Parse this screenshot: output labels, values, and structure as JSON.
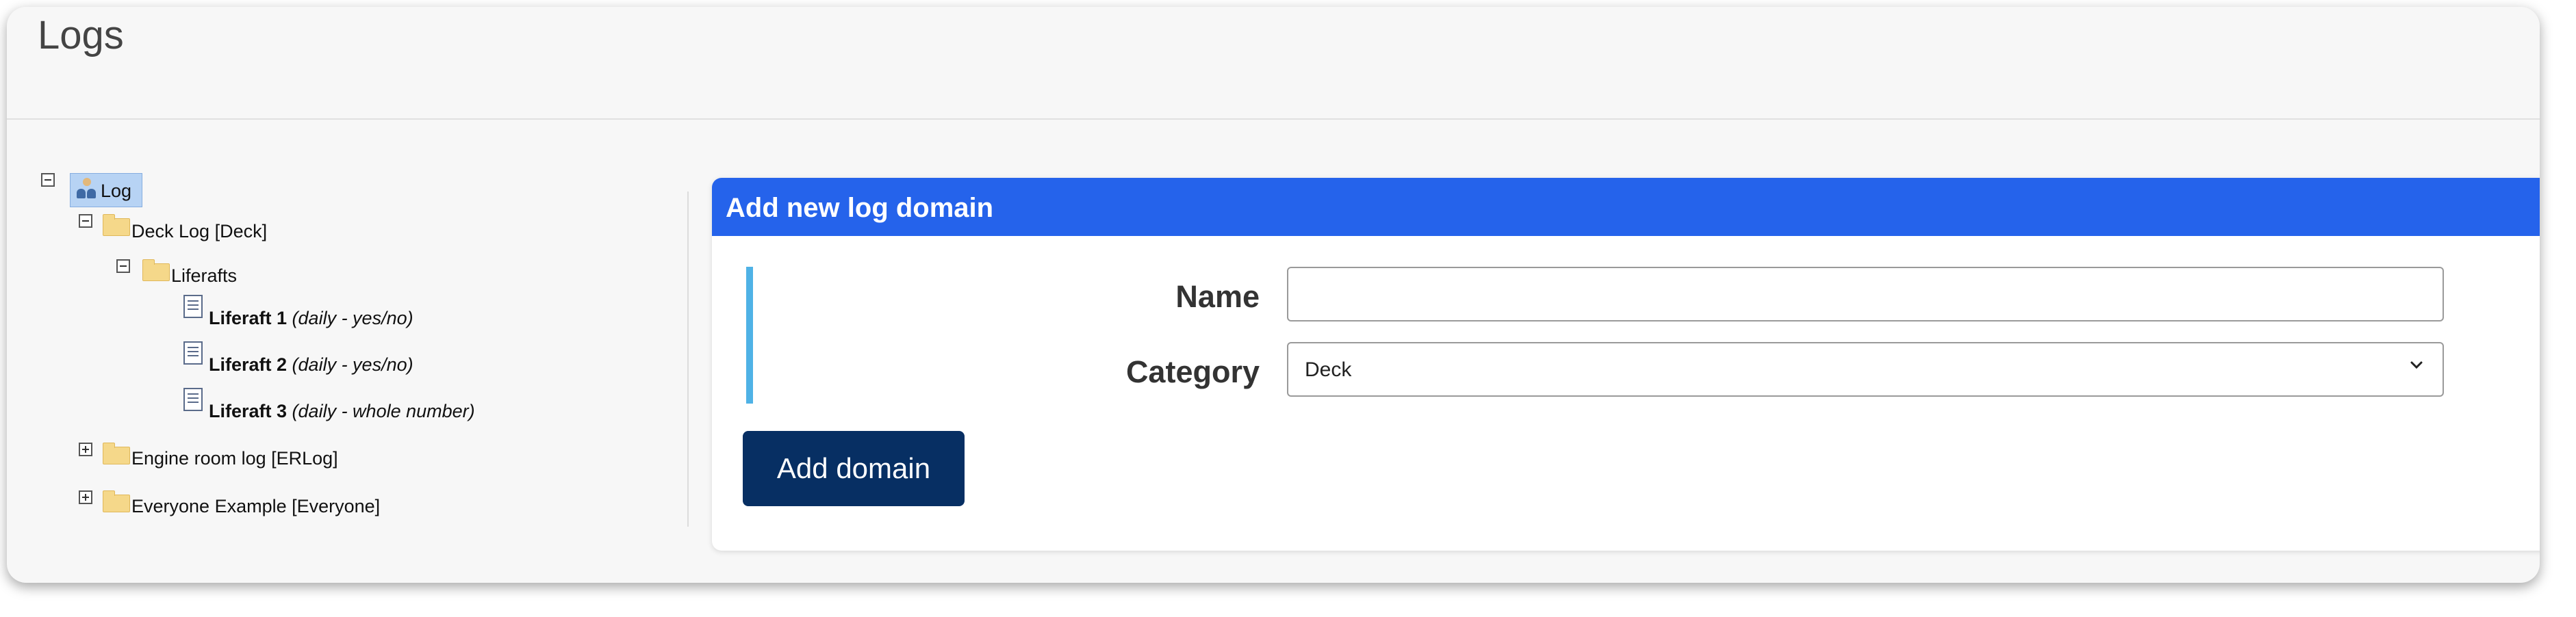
{
  "page": {
    "title": "Logs"
  },
  "tree": {
    "root": {
      "label": "Log"
    },
    "deck": {
      "label": "Deck Log [Deck]"
    },
    "liferafts": {
      "label": "Liferafts"
    },
    "items": [
      {
        "name": "Liferaft 1",
        "type": "(daily - yes/no)"
      },
      {
        "name": "Liferaft 2",
        "type": "(daily - yes/no)"
      },
      {
        "name": "Liferaft 3",
        "type": "(daily - whole number)"
      }
    ],
    "engine": {
      "label": "Engine room log [ERLog]"
    },
    "everyone": {
      "label": "Everyone Example [Everyone]"
    }
  },
  "panel": {
    "title": "Add new log domain",
    "name_label": "Name",
    "name_value": "",
    "category_label": "Category",
    "category_value": "Deck",
    "add_button": "Add domain"
  },
  "colors": {
    "header": "#2563eb",
    "button": "#072f63",
    "accent": "#4fb2e6",
    "selected": "#b7d3f4"
  }
}
